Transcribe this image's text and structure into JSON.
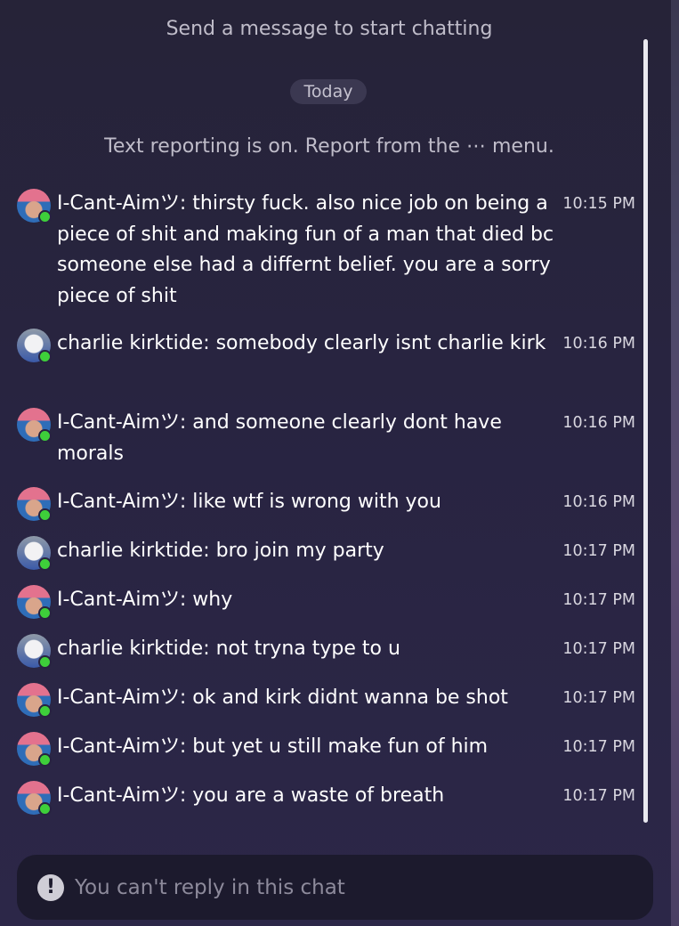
{
  "system": {
    "empty_prompt": "Send a message to start chatting",
    "date_label": "Today",
    "reporting_notice": "Text reporting is on. Report from the ⋯ menu."
  },
  "messages": [
    {
      "user": "I-Cant-Aimツ",
      "text": "I-Cant-Aimツ: thirsty fuck. also nice job on being a piece of shit and making fun of a man that died bc someone else had a differnt belief. you are a sorry piece of shit",
      "time": "10:15 PM",
      "avatar": "pink-hair-avatar"
    },
    {
      "user": "charlie kirktide",
      "text": "charlie kirktide: somebody clearly isnt charlie kirk",
      "time": "10:16 PM",
      "avatar": "grey-skull-avatar"
    },
    {
      "user": "I-Cant-Aimツ",
      "text": "I-Cant-Aimツ: and someone clearly dont have morals",
      "time": "10:16 PM",
      "avatar": "pink-hair-avatar"
    },
    {
      "user": "I-Cant-Aimツ",
      "text": "I-Cant-Aimツ: like wtf is wrong with you",
      "time": "10:16 PM",
      "avatar": "pink-hair-avatar"
    },
    {
      "user": "charlie kirktide",
      "text": "charlie kirktide: bro join my party",
      "time": "10:17 PM",
      "avatar": "grey-skull-avatar"
    },
    {
      "user": "I-Cant-Aimツ",
      "text": "I-Cant-Aimツ: why",
      "time": "10:17 PM",
      "avatar": "pink-hair-avatar"
    },
    {
      "user": "charlie kirktide",
      "text": "charlie kirktide: not tryna type to u",
      "time": "10:17 PM",
      "avatar": "grey-skull-avatar"
    },
    {
      "user": "I-Cant-Aimツ",
      "text": "I-Cant-Aimツ: ok and kirk didnt wanna be shot",
      "time": "10:17 PM",
      "avatar": "pink-hair-avatar"
    },
    {
      "user": "I-Cant-Aimツ",
      "text": "I-Cant-Aimツ: but yet u still make fun of him",
      "time": "10:17 PM",
      "avatar": "pink-hair-avatar"
    },
    {
      "user": "I-Cant-Aimツ",
      "text": "I-Cant-Aimツ: you are a waste of breath",
      "time": "10:17 PM",
      "avatar": "pink-hair-avatar"
    }
  ],
  "reply_bar": {
    "icon": "exclamation-icon",
    "text": "You can't reply in this chat"
  },
  "colors": {
    "online_status": "#3ecf3a",
    "background": "#282441",
    "reply_bar": "#1c1a2d"
  }
}
